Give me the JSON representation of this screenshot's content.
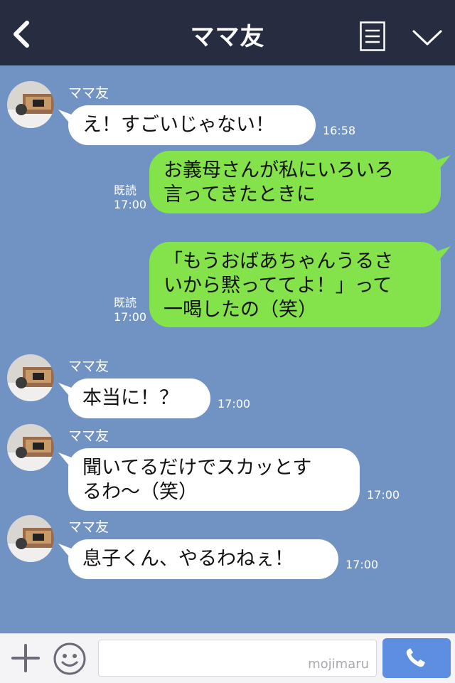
{
  "header": {
    "title": "ママ友"
  },
  "messages": [
    {
      "sender": "ママ友",
      "text": "え！すごいじゃない！",
      "time": "16:58"
    },
    {
      "text": "お義母さんが私にいろいろ\n言ってきたときに",
      "read": "既読",
      "time": "17:00"
    },
    {
      "text": "「もうおばあちゃんうるさ\nいから黙っててよ！」って\n一喝したの（笑）",
      "read": "既読",
      "time": "17:00"
    },
    {
      "sender": "ママ友",
      "text": "本当に！？",
      "time": "17:00"
    },
    {
      "sender": "ママ友",
      "text": "聞いてるだけでスカッとす\nるわ〜（笑）",
      "time": "17:00"
    },
    {
      "sender": "ママ友",
      "text": "息子くん、やるわねぇ！",
      "time": "17:00"
    }
  ],
  "footer": {
    "watermark": "mojimaru"
  },
  "colors": {
    "header_bg": "#262d41",
    "chat_bg": "#7093c3",
    "outgoing_bubble": "#84e24a",
    "incoming_bubble": "#ffffff",
    "call_button": "#5e8ee0"
  },
  "icons": [
    "back-chevron-icon",
    "menu-list-icon",
    "chevron-down-icon",
    "plus-icon",
    "smiley-icon",
    "phone-icon"
  ]
}
